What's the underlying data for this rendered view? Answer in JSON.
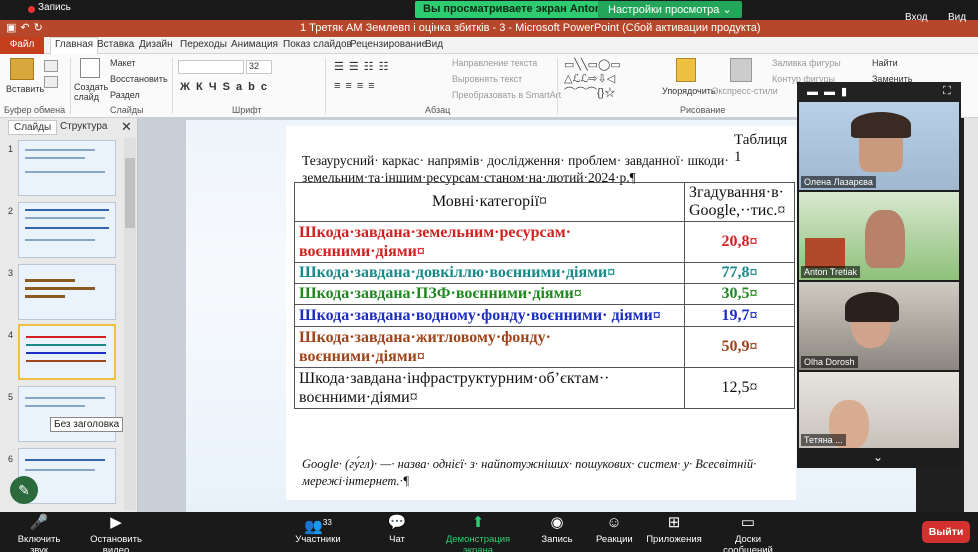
{
  "zoom": {
    "share_banner": "Вы просматриваете экран Anton Tretiak",
    "view_settings": "Настройки просмотра",
    "recording": "Запись",
    "enter": "Вход",
    "view": "Вид"
  },
  "pp": {
    "title": "1 Третяк АМ Землевп і оцінка збитків - 3 - Microsoft PowerPoint (Сбой активации продукта)",
    "tabs": [
      "Файл",
      "Главная",
      "Вставка",
      "Дизайн",
      "Переходы",
      "Анимация",
      "Показ слайдов",
      "Рецензирование",
      "Вид"
    ],
    "ribbon": {
      "paste": "Вставить",
      "clipboard": "Буфер обмена",
      "create_slide": "Создать слайд",
      "layout": "Макет",
      "reset": "Восстановить",
      "section": "Раздел",
      "slides_group": "Слайды",
      "font_size": "32",
      "font_group": "Шрифт",
      "text_direction": "Направление текста",
      "align_text": "Выровнять текст",
      "smartart": "Преобразовать в SmartArt",
      "paragraph": "Абзац",
      "arrange": "Упорядочить",
      "quick_styles": "Экспресс-стили",
      "drawing": "Рисование",
      "fill": "Заливка фигуры",
      "outline": "Контур фигуры",
      "effects": "Эф",
      "find": "Найти",
      "replace": "Заменить"
    },
    "panel_tabs": [
      "Слайды",
      "Структура"
    ],
    "slide_numbers": [
      "1",
      "2",
      "3",
      "4",
      "5",
      "6"
    ],
    "tooltip": "Без заголовка"
  },
  "doc": {
    "table_no": "Таблиця 1",
    "caption_line1": "Тезаурусний· каркас· напрямів· дослідження· проблем· завданної· шкоди· земельним·та·іншим·ресурсам·станом·на·лютий·2024·р.¶",
    "col1": "Мовні·категорії¤",
    "col2": "Згадування·в· Google,··тис.¤",
    "rows": [
      {
        "label": "Шкода·завдана·земельним·ресурсам· воєнними·діями¤",
        "value": "20,8¤",
        "color": "#d42020"
      },
      {
        "label": "Шкода·завдана·довкіллю·воєнними·діями¤",
        "value": "77,8¤",
        "color": "#178a8a"
      },
      {
        "label": "Шкода·завдана·ПЗФ·воєнними·діями¤",
        "value": "30,5¤",
        "color": "#1e8a1e"
      },
      {
        "label": "Шкода·завдана·водному·фонду·воєнними· діями¤",
        "value": "19,7¤",
        "color": "#1c2ec2"
      },
      {
        "label": "Шкода·завдана·житловому·фонду· воєнними·діями¤",
        "value": "50,9¤",
        "color": "#a0441a"
      },
      {
        "label": "Шкода·завдана·інфраструктурним·об’єктам·· воєнними·діями¤",
        "value": "12,5¤",
        "color": "#111111"
      }
    ],
    "note": "Google· (гу́гл)· —· назва· однієї· з· найпотужніших· пошукових· систем· у· Всесвітній· мережі·інтернет.·¶"
  },
  "gallery": {
    "participants": [
      "Олена Лазарєва",
      "Anton Tretiak",
      "Olha Dorosh",
      "Тетяна ..."
    ]
  },
  "toolbar": {
    "mute": "Включить звук",
    "video": "Остановить видео",
    "participants": "Участники",
    "participants_count": "33",
    "chat": "Чат",
    "share": "Демонстрация экрана",
    "record": "Запись",
    "reactions": "Реакции",
    "apps": "Приложения",
    "whiteboards": "Доски сообщений",
    "leave": "Выйти"
  }
}
